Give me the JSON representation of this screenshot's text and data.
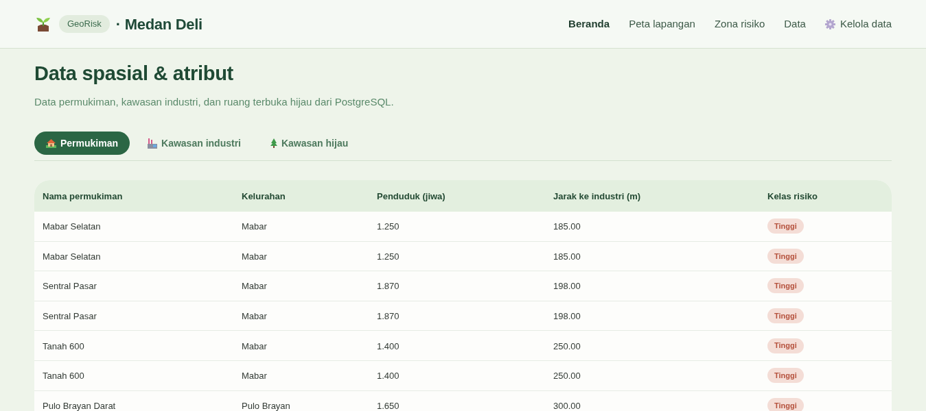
{
  "header": {
    "brand_badge": "GeoRisk",
    "brand_title": "· Medan Deli",
    "nav": [
      {
        "label": "Beranda",
        "selected": true,
        "kind": "link"
      },
      {
        "label": "Peta lapangan",
        "selected": false,
        "kind": "link"
      },
      {
        "label": "Zona risiko",
        "selected": false,
        "kind": "link"
      },
      {
        "label": "Data",
        "selected": false,
        "kind": "link"
      },
      {
        "label": "Kelola data",
        "selected": false,
        "kind": "settings"
      }
    ]
  },
  "page": {
    "title": "Data spasial & atribut",
    "subtitle": "Data permukiman, kawasan industri, dan ruang terbuka hijau dari PostgreSQL."
  },
  "tabs": [
    {
      "label": "Permukiman",
      "selected": true,
      "kind": "settlement"
    },
    {
      "label": "Kawasan industri",
      "selected": false,
      "kind": "industry"
    },
    {
      "label": "Kawasan hijau",
      "selected": false,
      "kind": "green"
    }
  ],
  "table": {
    "columns": [
      "Nama permukiman",
      "Kelurahan",
      "Penduduk (jiwa)",
      "Jarak ke industri (m)",
      "Kelas risiko"
    ],
    "rows": [
      {
        "name": "Mabar Selatan",
        "kelurahan": "Mabar",
        "population": "1.250",
        "distance": "185.00",
        "risk": "Tinggi"
      },
      {
        "name": "Mabar Selatan",
        "kelurahan": "Mabar",
        "population": "1.250",
        "distance": "185.00",
        "risk": "Tinggi"
      },
      {
        "name": "Sentral Pasar",
        "kelurahan": "Mabar",
        "population": "1.870",
        "distance": "198.00",
        "risk": "Tinggi"
      },
      {
        "name": "Sentral Pasar",
        "kelurahan": "Mabar",
        "population": "1.870",
        "distance": "198.00",
        "risk": "Tinggi"
      },
      {
        "name": "Tanah 600",
        "kelurahan": "Mabar",
        "population": "1.400",
        "distance": "250.00",
        "risk": "Tinggi"
      },
      {
        "name": "Tanah 600",
        "kelurahan": "Mabar",
        "population": "1.400",
        "distance": "250.00",
        "risk": "Tinggi"
      },
      {
        "name": "Pulo Brayan Darat",
        "kelurahan": "Pulo Brayan",
        "population": "1.650",
        "distance": "300.00",
        "risk": "Tinggi"
      }
    ]
  }
}
